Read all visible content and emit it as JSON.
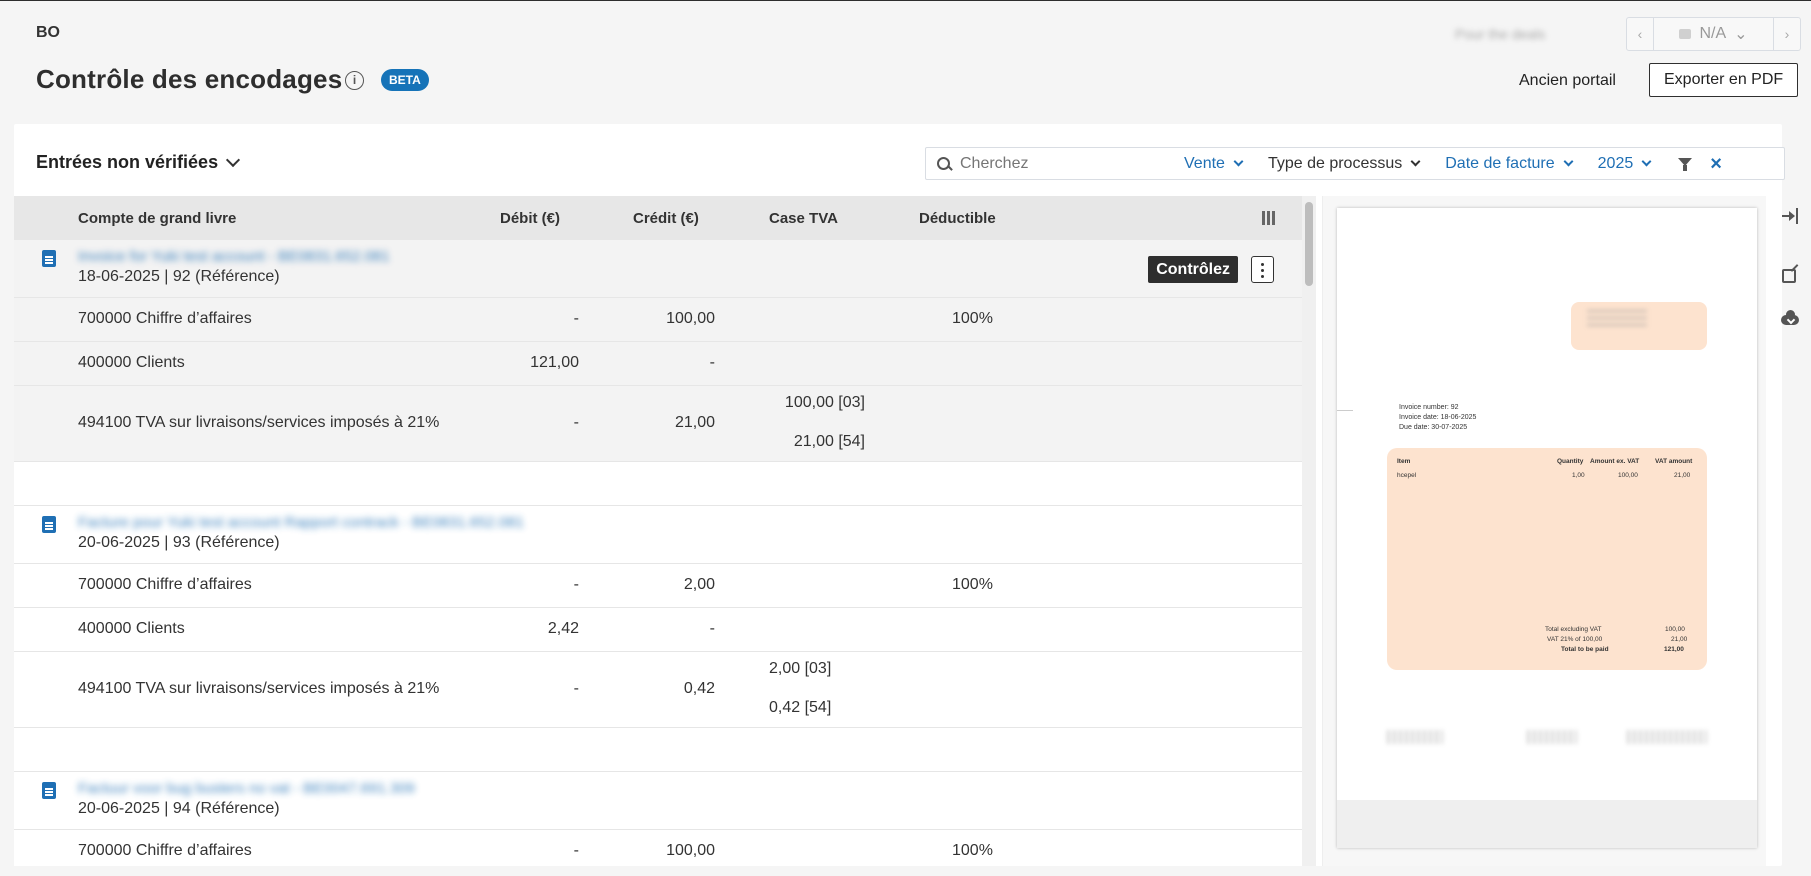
{
  "header": {
    "org": "BO",
    "title": "Contrôle des encodages",
    "beta_badge": "BETA",
    "top_right_blurred": "Pour the deals",
    "nav_value": "N/A",
    "ancien_portail": "Ancien portail",
    "export_pdf": "Exporter en PDF"
  },
  "toolbar": {
    "entries_label": "Entrées non vérifiées",
    "search_placeholder": "Cherchez",
    "filters": [
      {
        "label": "Vente",
        "active": true
      },
      {
        "label": "Type de processus",
        "active": false
      },
      {
        "label": "Date de facture",
        "active": true
      },
      {
        "label": "2025",
        "active": true
      }
    ]
  },
  "table": {
    "headers": {
      "account": "Compte de grand livre",
      "debit": "Débit (€)",
      "credit": "Crédit (€)",
      "vat_case": "Case TVA",
      "deductible": "Déductible"
    },
    "controle_label": "Contrôlez",
    "groups": [
      {
        "title": "Invoice for Yuki test account - BE0831.652.081",
        "subtitle": "18-06-2025 | 92 (Référence)",
        "rows": [
          {
            "account": "700000 Chiffre d’affaires",
            "debit": "-",
            "credit": "100,00",
            "vat1": "",
            "vat2": "",
            "deductible": "100%"
          },
          {
            "account": "400000 Clients",
            "debit": "121,00",
            "credit": "-",
            "vat1": "",
            "vat2": "",
            "deductible": ""
          },
          {
            "account": "494100 TVA sur livraisons/services imposés à 21%",
            "debit": "-",
            "credit": "21,00",
            "vat1": "100,00 [03]",
            "vat2": "21,00 [54]",
            "deductible": ""
          }
        ]
      },
      {
        "title": "Facture pour Yuki test account Rapport contrack - BE0831.652.081",
        "subtitle": "20-06-2025 | 93 (Référence)",
        "rows": [
          {
            "account": "700000 Chiffre d’affaires",
            "debit": "-",
            "credit": "2,00",
            "vat1": "",
            "vat2": "",
            "deductible": "100%"
          },
          {
            "account": "400000 Clients",
            "debit": "2,42",
            "credit": "-",
            "vat1": "",
            "vat2": "",
            "deductible": ""
          },
          {
            "account": "494100 TVA sur livraisons/services imposés à 21%",
            "debit": "-",
            "credit": "0,42",
            "vat1": "2,00 [03]",
            "vat2": "0,42 [54]",
            "deductible": ""
          }
        ]
      },
      {
        "title": "Factuur voor bug busters no vat - BE0047.691.309",
        "subtitle": "20-06-2025 | 94 (Référence)",
        "rows": [
          {
            "account": "700000 Chiffre d’affaires",
            "debit": "-",
            "credit": "100,00",
            "vat1": "",
            "vat2": "",
            "deductible": "100%"
          }
        ]
      }
    ]
  },
  "pdf": {
    "invoice_number": "Invoice number: 92",
    "invoice_date": "Invoice date: 18-06-2025",
    "due_date": "Due date: 30-07-2025",
    "item_header": "Item",
    "qty_header": "Quantity",
    "amount_header": "Amount ex. VAT",
    "vat_header": "VAT amount",
    "item_name": "hcepel",
    "item_qty": "1,00",
    "item_amount": "100,00",
    "item_vat": "21,00",
    "total_excl_label": "Total excluding VAT",
    "total_excl_value": "100,00",
    "vat_line_label": "VAT 21% of 100,00",
    "vat_line_value": "21,00",
    "total_paid_label": "Total to be paid",
    "total_paid_value": "121,00"
  },
  "colors": {
    "accent_blue": "#2b8ccf",
    "link_blue": "#1f6fb4",
    "beta_blue": "#1673b8",
    "pdf_orange": "#fde3cf"
  }
}
